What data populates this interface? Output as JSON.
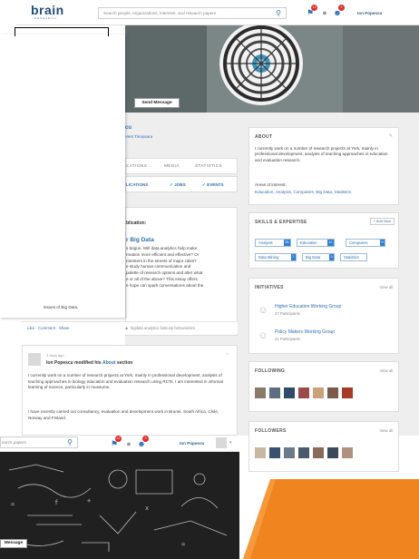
{
  "header": {
    "logo": "brain",
    "logo_sub": "RESEARCH",
    "search_placeholder": "Search people, organizations, interests, and research papers",
    "notifications_count": "12",
    "messages_count": "3",
    "username": "Ion Popescu"
  },
  "profile": {
    "name_fragment": "cu",
    "location_fragment": "Vest Timișoara",
    "send_message": "Send Message"
  },
  "tabs": [
    "CATIONS",
    "MEDIA",
    "STATISTICS"
  ],
  "subtabs": [
    "LICATIONS",
    "✓ JOBS",
    "✓ EVENTS"
  ],
  "post1": {
    "heading": "blication:",
    "title": "r Big Data",
    "body_lines": [
      "s begun. Will data analytics help make",
      "rmation more efficient and effective? Or",
      "rotesters in the streets of major cities?",
      "e study human communication and",
      "palette of research options and alter what",
      "e or all of the above? This essay offers",
      "e hope can spark conversations about the"
    ],
    "last_line": "issues of Big Data.",
    "actions": "Like · Comment · Share",
    "tags": "bigdata  analytics  fastcorp  behaviorism"
  },
  "post2": {
    "time": "2 days ago",
    "author": "Ion Popescu",
    "action_pre": "modified his",
    "action_link": "About",
    "action_post": "section",
    "para1": "I currently work on a number of research projects at York, mainly in professional development, analysis of teaching approaches in biology education and evaluation research using RCTs. I am interested in informal learning of science, particularly in museums.",
    "para2": "I have recently carried out consultancy, evaluation and development work in Brunei, South Africa, Chile, Norway and Finland."
  },
  "about": {
    "title": "ABOUT",
    "text": "I currently work on a number of research projects at York, mainly in professional development, analysis of teaching approaches in education and evaluation research.",
    "areas_label": "Areas of interest:",
    "areas": "Education, Analysis, Computers, Big Data, Statistics."
  },
  "skills": {
    "title": "SKILLS & EXPERTISE",
    "add": "+ Add New",
    "items": [
      {
        "label": "Analysis",
        "count": "35"
      },
      {
        "label": "Education",
        "count": "12"
      },
      {
        "label": "Computers",
        "count": "9"
      },
      {
        "label": "Data Mining",
        "count": "7"
      },
      {
        "label": "Big Data",
        "count": "3"
      },
      {
        "label": "Statistics",
        "count": ""
      }
    ]
  },
  "initiatives": {
    "title": "INITIATIVES",
    "view_all": "View all",
    "items": [
      {
        "name": "Higher Education Working Group",
        "sub": "27 Participants"
      },
      {
        "name": "Policy Makers Working Group",
        "sub": "41 Participants"
      }
    ]
  },
  "following": {
    "title": "FOLLOWING",
    "view_all": "View all"
  },
  "followers": {
    "title": "FOLLOWERS",
    "view_all": "View all"
  },
  "bottom": {
    "search_fragment": "earch papers",
    "notifications_count": "12",
    "messages_count": "3",
    "username": "Ion Popescu",
    "send_message": "Message"
  },
  "colors": {
    "brand": "#1f4e79",
    "link": "#2f6fb6",
    "badge": "#e02b2b",
    "accent_orange": "#f0841e"
  }
}
